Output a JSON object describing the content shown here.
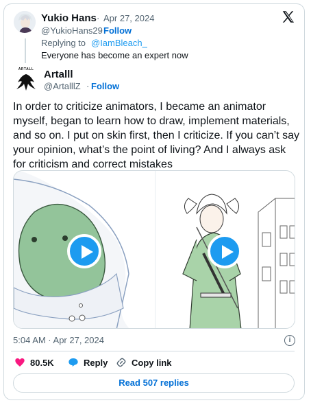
{
  "quoted_tweet": {
    "display_name": "Yukio Hans",
    "separator": "·",
    "date": "Apr 27, 2024",
    "handle": "@YukioHans29",
    "follow_label": "Follow",
    "replying_prefix": "Replying to",
    "replying_to": "@IamBleach_",
    "text": "Everyone has become an expert now"
  },
  "tweet": {
    "display_name": "Artalll",
    "handle": "@ArtalllZ",
    "follow_label": "Follow",
    "avatar_text": "ARTALL",
    "text": "In order to criticize animators, I became an animator myself, began to learn how to draw, implement materials, and so on. I put on skin first, then I criticize. If you can’t say your opinion, what’s the point of living? And I always ask for criticism and correct mistakes",
    "timestamp": "5:04 AM · Apr 27, 2024",
    "likes": "80.5K",
    "reply_label": "Reply",
    "copy_link_label": "Copy link",
    "read_replies_label": "Read 507 replies"
  },
  "icons": {
    "brand": "x-logo-icon",
    "info": "info-icon",
    "like": "heart-icon",
    "reply": "speech-bubble-icon",
    "copy": "link-icon",
    "play": "play-icon"
  },
  "colors": {
    "accent": "#1d9bf0",
    "link": "#006fd6",
    "like": "#f91880",
    "muted": "#536471",
    "border": "#cfd9de"
  }
}
